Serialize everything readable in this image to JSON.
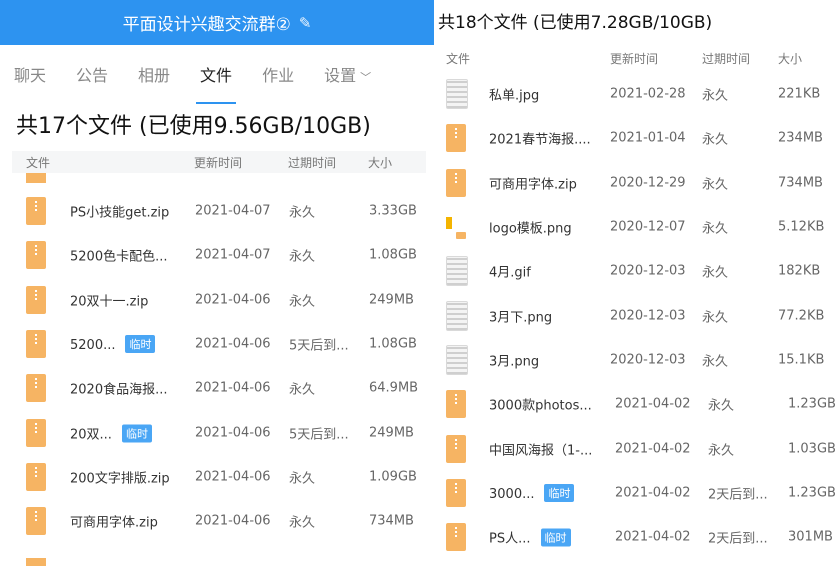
{
  "left": {
    "group_title": "平面设计兴趣交流群②",
    "tabs": [
      {
        "label": "聊天"
      },
      {
        "label": "公告"
      },
      {
        "label": "相册"
      },
      {
        "label": "文件"
      },
      {
        "label": "作业"
      },
      {
        "label": "设置"
      }
    ],
    "active_tab": "文件",
    "summary": "共17个文件 (已使用9.56GB/10GB)",
    "columns": {
      "file": "文件",
      "date": "更新时间",
      "expire": "过期时间",
      "size": "大小"
    },
    "files": [
      {
        "name": "PS小技能get.zip",
        "date": "2021-04-07",
        "expire": "永久",
        "size": "3.33GB",
        "type": "zip"
      },
      {
        "name": "5200色卡配色...",
        "date": "2021-04-07",
        "expire": "永久",
        "size": "1.08GB",
        "type": "zip"
      },
      {
        "name": "20双十一.zip",
        "date": "2021-04-06",
        "expire": "永久",
        "size": "249MB",
        "type": "zip"
      },
      {
        "name": "5200...",
        "badge": "临时",
        "date": "2021-04-06",
        "expire": "5天后到...",
        "size": "1.08GB",
        "type": "zip"
      },
      {
        "name": "2020食品海报...",
        "date": "2021-04-06",
        "expire": "永久",
        "size": "64.9MB",
        "type": "zip"
      },
      {
        "name": "20双...",
        "badge": "临时",
        "date": "2021-04-06",
        "expire": "5天后到...",
        "size": "249MB",
        "type": "zip"
      },
      {
        "name": "200文字排版.zip",
        "date": "2021-04-06",
        "expire": "永久",
        "size": "1.09GB",
        "type": "zip"
      },
      {
        "name": "可商用字体.zip",
        "date": "2021-04-06",
        "expire": "永久",
        "size": "734MB",
        "type": "zip"
      }
    ]
  },
  "right": {
    "summary": "共18个文件 (已使用7.28GB/10GB)",
    "columns": {
      "file": "文件",
      "date": "更新时间",
      "expire": "过期时间",
      "size": "大小"
    },
    "files": [
      {
        "name": "私单.jpg",
        "date": "2021-02-28",
        "expire": "永久",
        "size": "221KB",
        "type": "img"
      },
      {
        "name": "2021春节海报....",
        "date": "2021-01-04",
        "expire": "永久",
        "size": "234MB",
        "type": "zip"
      },
      {
        "name": "可商用字体.zip",
        "date": "2020-12-29",
        "expire": "永久",
        "size": "734MB",
        "type": "zip"
      },
      {
        "name": "logo模板.png",
        "date": "2020-12-07",
        "expire": "永久",
        "size": "5.12KB",
        "type": "logo"
      },
      {
        "name": "4月.gif",
        "date": "2020-12-03",
        "expire": "永久",
        "size": "182KB",
        "type": "img"
      },
      {
        "name": "3月下.png",
        "date": "2020-12-03",
        "expire": "永久",
        "size": "77.2KB",
        "type": "img"
      },
      {
        "name": "3月.png",
        "date": "2020-12-03",
        "expire": "永久",
        "size": "15.1KB",
        "type": "img"
      },
      {
        "name": "3000款photos...",
        "date": "2021-04-02",
        "expire": "永久",
        "size": "1.23GB",
        "type": "zip"
      },
      {
        "name": "中国风海报（1-...",
        "date": "2021-04-02",
        "expire": "永久",
        "size": "1.03GB",
        "type": "zip"
      },
      {
        "name": "3000...",
        "badge": "临时",
        "date": "2021-04-02",
        "expire": "2天后到...",
        "size": "1.23GB",
        "type": "zip"
      },
      {
        "name": "PS人...",
        "badge": "临时",
        "date": "2021-04-02",
        "expire": "2天后到...",
        "size": "301MB",
        "type": "zip"
      }
    ]
  },
  "colors": {
    "title_bar": "#2d93f0",
    "zip_icon": "#f6b463",
    "badge": "#4aa6f5",
    "accent": "#2d93f0"
  }
}
